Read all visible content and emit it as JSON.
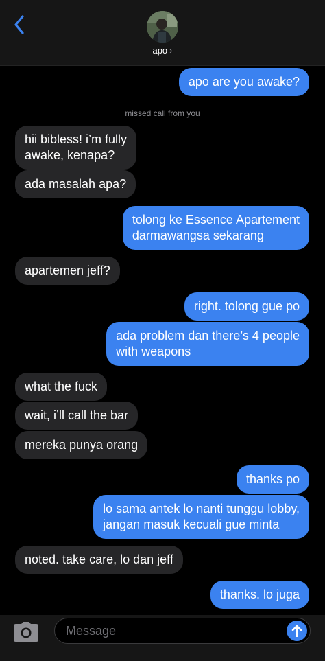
{
  "header": {
    "contact_name": "apo",
    "back_icon": "chevron-left-icon",
    "accent": "#3b82f0"
  },
  "thread": {
    "missed_call": "missed call from you",
    "messages": [
      {
        "from": "me",
        "lines": [
          "apo are you awake?"
        ]
      },
      {
        "from": "them",
        "lines": [
          "hii bibless! i’m fully",
          "awake, kenapa?"
        ]
      },
      {
        "from": "them",
        "lines": [
          "ada masalah apa?"
        ]
      },
      {
        "from": "me",
        "lines": [
          "tolong ke Essence Apartement",
          "darmawangsa sekarang"
        ]
      },
      {
        "from": "them",
        "lines": [
          "apartemen jeff?"
        ]
      },
      {
        "from": "me",
        "lines": [
          "right. tolong gue po"
        ]
      },
      {
        "from": "me",
        "lines": [
          "ada problem dan there’s 4 people",
          "with weapons"
        ]
      },
      {
        "from": "them",
        "lines": [
          "what the fuck"
        ]
      },
      {
        "from": "them",
        "lines": [
          "wait, i’ll call the bar"
        ]
      },
      {
        "from": "them",
        "lines": [
          "mereka punya orang"
        ]
      },
      {
        "from": "me",
        "lines": [
          "thanks po"
        ]
      },
      {
        "from": "me",
        "lines": [
          "lo sama antek lo nanti tunggu lobby,",
          "jangan masuk kecuali gue minta"
        ]
      },
      {
        "from": "them",
        "lines": [
          "noted. take care, lo dan jeff"
        ]
      },
      {
        "from": "me",
        "lines": [
          "thanks. lo juga"
        ]
      }
    ]
  },
  "composer": {
    "placeholder": "Message",
    "camera_icon": "camera-icon",
    "send_icon": "arrow-up-icon"
  }
}
